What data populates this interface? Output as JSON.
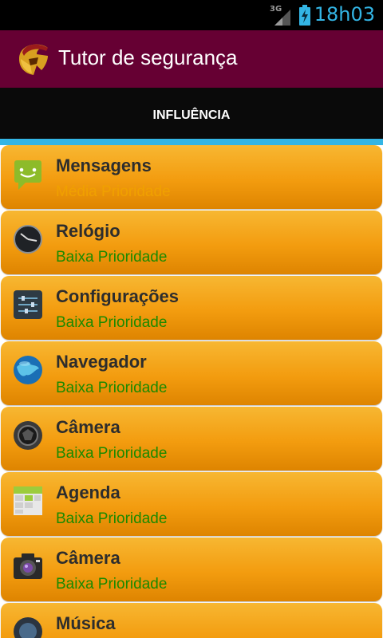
{
  "status_bar": {
    "network": "3G",
    "time": "18h03"
  },
  "app_bar": {
    "title": "Tutor de segurança",
    "color": "#660033"
  },
  "tab": {
    "label": "INFLUÊNCIA",
    "indicator_color": "#33b5e5"
  },
  "colors": {
    "medium": "#f0a000",
    "low": "#1b8a00",
    "card": "#f39c0f"
  },
  "apps": [
    {
      "name": "Mensagens",
      "priority": "Média Prioridade",
      "level": "medium",
      "icon": "messages-icon"
    },
    {
      "name": "Relógio",
      "priority": "Baixa Prioridade",
      "level": "low",
      "icon": "clock-icon"
    },
    {
      "name": "Configurações",
      "priority": "Baixa Prioridade",
      "level": "low",
      "icon": "settings-icon"
    },
    {
      "name": "Navegador",
      "priority": "Baixa Prioridade",
      "level": "low",
      "icon": "browser-globe-icon"
    },
    {
      "name": "Câmera",
      "priority": "Baixa Prioridade",
      "level": "low",
      "icon": "camera-lens-icon"
    },
    {
      "name": "Agenda",
      "priority": "Baixa Prioridade",
      "level": "low",
      "icon": "calendar-icon"
    },
    {
      "name": "Câmera",
      "priority": "Baixa Prioridade",
      "level": "low",
      "icon": "camera-icon"
    },
    {
      "name": "Música",
      "priority": "",
      "level": "low",
      "icon": "music-icon"
    }
  ]
}
